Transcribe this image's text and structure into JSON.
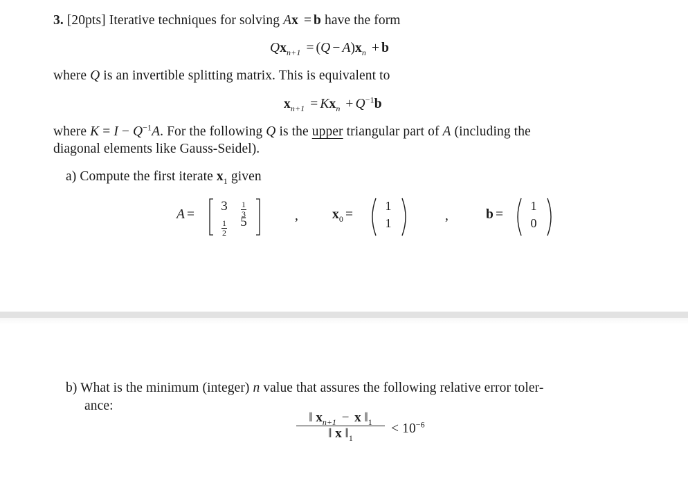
{
  "problem": {
    "number": "3.",
    "points": "[20pts]",
    "intro": "Iterative techniques for solving",
    "intro_eq_lhs_A": "A",
    "intro_eq_lhs_x": "x",
    "intro_eq_eq": "=",
    "intro_eq_b": "b",
    "intro_tail": "have the form",
    "eq1": {
      "Q": "Q",
      "x": "x",
      "sub_n1": "n+1",
      "eq": "=",
      "paren_open": "(",
      "Q2": "Q",
      "minus": "−",
      "A": "A",
      "paren_close": ")",
      "x2": "x",
      "sub_n": "n",
      "plus": "+",
      "b": "b"
    },
    "line2_pre": "where",
    "line2_Q": "Q",
    "line2_post": "is an invertible splitting matrix. This is equivalent to",
    "eq2": {
      "x": "x",
      "sub_n1": "n+1",
      "eq": "=",
      "K": "K",
      "x2": "x",
      "sub_n": "n",
      "plus": "+",
      "Q": "Q",
      "sup": "−1",
      "b": "b"
    },
    "line3_where": "where",
    "line3_K": "K",
    "line3_eq": "=",
    "line3_I": "I",
    "line3_minus": "−",
    "line3_Q": "Q",
    "line3_sup": "−1",
    "line3_A": "A",
    "line3_mid": ". For the following",
    "line3_Q2": "Q",
    "line3_isthe": "is the",
    "line3_upper": "upper",
    "line3_tail": "triangular part of",
    "line3_A2": "A",
    "line3_end": "(including the",
    "line4": "diagonal elements like Gauss-Seidel)."
  },
  "part_a": {
    "label": "a)",
    "text": "Compute the first iterate",
    "x": "x",
    "sub": "1",
    "given": "given",
    "A_label": "A",
    "eq": "=",
    "A_matrix": {
      "a11": "3",
      "a12_num": "1",
      "a12_den": "3",
      "a21_num": "1",
      "a21_den": "2",
      "a22": "5"
    },
    "comma": ",",
    "x0_label": "x",
    "x0_sub": "0",
    "x0": [
      "1",
      "1"
    ],
    "b_label": "b",
    "b": [
      "1",
      "0"
    ]
  },
  "part_b": {
    "label": "b)",
    "text": "What is the minimum (integer)",
    "n": "n",
    "text2": "value that assures the following relative error toler-",
    "line2": "ance:",
    "num_norm_open": "‖",
    "num_x": "x",
    "num_sub": "n+1",
    "num_minus": "−",
    "num_x2": "x",
    "num_norm_close": "‖",
    "norm_sub": "1",
    "den_x": "x",
    "lt": "<",
    "tol_base": "10",
    "tol_exp": "−6"
  }
}
